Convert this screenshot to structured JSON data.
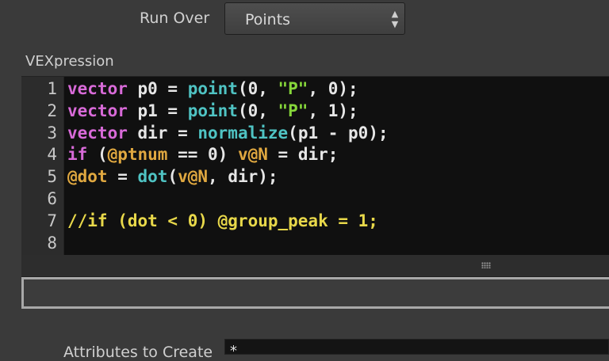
{
  "run_over": {
    "label": "Run Over",
    "value": "Points"
  },
  "vex": {
    "label": "VEXpression",
    "lines": [
      {
        "n": "1",
        "tokens": [
          {
            "t": "vector",
            "c": "kw"
          },
          {
            "t": " p0 = "
          },
          {
            "t": "point",
            "c": "fn"
          },
          {
            "t": "(0, "
          },
          {
            "t": "\"P\"",
            "c": "str"
          },
          {
            "t": ", 0);"
          }
        ]
      },
      {
        "n": "2",
        "tokens": [
          {
            "t": "vector",
            "c": "kw"
          },
          {
            "t": " p1 = "
          },
          {
            "t": "point",
            "c": "fn"
          },
          {
            "t": "(0, "
          },
          {
            "t": "\"P\"",
            "c": "str"
          },
          {
            "t": ", 1);"
          }
        ]
      },
      {
        "n": "3",
        "tokens": [
          {
            "t": "vector",
            "c": "kw"
          },
          {
            "t": " dir = "
          },
          {
            "t": "normalize",
            "c": "fn"
          },
          {
            "t": "(p1 - p0);"
          }
        ]
      },
      {
        "n": "4",
        "tokens": [
          {
            "t": "if",
            "c": "kw"
          },
          {
            "t": " ("
          },
          {
            "t": "@ptnum",
            "c": "attr"
          },
          {
            "t": " == 0) "
          },
          {
            "t": "v@N",
            "c": "attr"
          },
          {
            "t": " = dir;"
          }
        ]
      },
      {
        "n": "5",
        "tokens": [
          {
            "t": "@dot",
            "c": "attr"
          },
          {
            "t": " = "
          },
          {
            "t": "dot",
            "c": "fn"
          },
          {
            "t": "("
          },
          {
            "t": "v@N",
            "c": "attr"
          },
          {
            "t": ", dir);"
          }
        ]
      },
      {
        "n": "6",
        "tokens": []
      },
      {
        "n": "7",
        "tokens": [
          {
            "t": "//if (dot < 0) @group_peak = 1;",
            "c": "cm"
          }
        ]
      },
      {
        "n": "8",
        "tokens": []
      }
    ]
  },
  "attributes": {
    "label": "Attributes to Create",
    "value": "*"
  },
  "icons": {
    "dropdown": "up-down-arrows-icon",
    "resize": "resize-grip-icon"
  }
}
